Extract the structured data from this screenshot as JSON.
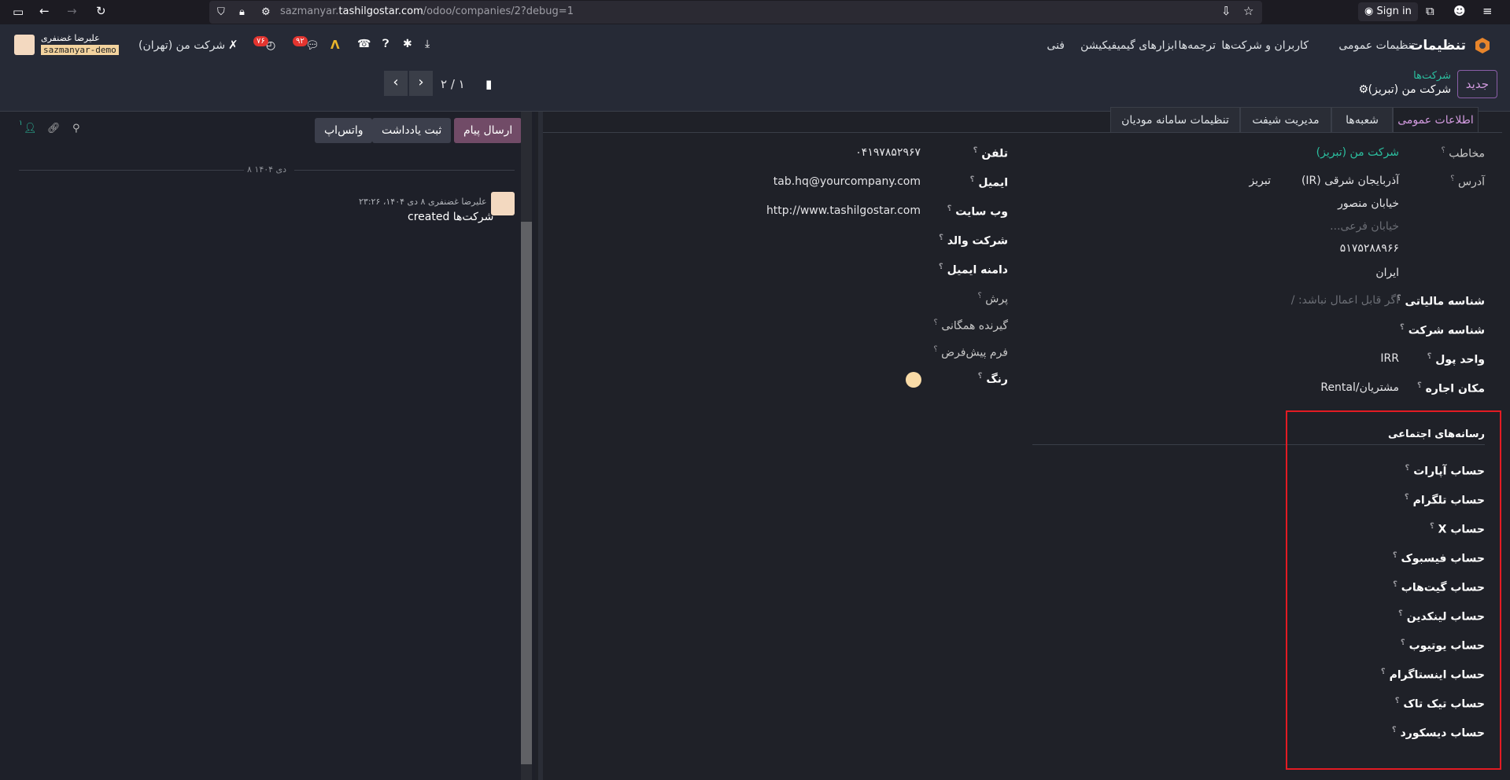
{
  "browser": {
    "url_prefix": "sazmanyar.",
    "url_domain": "tashilgostar.com",
    "url_path": "/odoo/companies/2?debug=1",
    "signin_label": "Sign in"
  },
  "navbar": {
    "app_name": "تنظیمات",
    "menu": [
      "تنظیمات عمومی",
      "کاربران و شرکت‌ها",
      "ترجمه‌ها",
      "ابزارهای گیمیفیکیشن",
      "فنی"
    ],
    "company": "شرکت من (تهران)",
    "user_name": "علیرضا غضنفری",
    "database": "sazmanyar-demo",
    "badge_activities": "۷۶",
    "badge_messages": "۹۲"
  },
  "control": {
    "new_label": "جدید",
    "breadcrumb_parent": "شرکت‌ها",
    "breadcrumb_current": "شرکت من (تبریز)",
    "pager": "۲ / ۱"
  },
  "chatter": {
    "send_message": "ارسال پیام",
    "log_note": "ثبت یادداشت",
    "whatsapp": "واتس‌اپ",
    "followers_count": "۱",
    "date_separator": "۸ دی ۱۴۰۴",
    "message_author": "علیرضا غضنفری",
    "message_time": "۸ دی ۱۴۰۴، ۲۳:۲۶",
    "message_body": "شرکت‌ها created"
  },
  "tabs": [
    "اطلاعات عمومی",
    "شعبه‌ها",
    "مدیریت شیفت",
    "تنظیمات سامانه مودیان"
  ],
  "left_fields": {
    "contact_label": "مخاطب",
    "contact_value": "شرکت من (تبریز)",
    "address_label": "آدرس",
    "state": "آذربایجان شرقی (IR)",
    "city": "تبریز",
    "street": "خیابان منصور",
    "street2_placeholder": "خیابان فرعی...",
    "zip": "۵۱۷۵۲۸۸۹۶۶",
    "country": "ایران",
    "tax_id_label": "شناسه مالیاتی",
    "tax_id_placeholder": "اگر قابل اعمال نباشد: /",
    "company_id_label": "شناسه شرکت",
    "currency_label": "واحد پول",
    "currency_value": "IRR",
    "rental_label": "مکان اجاره",
    "rental_value": "مشتریان/Rental"
  },
  "right_fields": {
    "phone_label": "تلفن",
    "phone_value": "۰۴۱۹۷۸۵۲۹۶۷",
    "email_label": "ایمیل",
    "email_value": "tab.hq@yourcompany.com",
    "website_label": "وب سایت",
    "website_value": "http://www.tashilgostar.com",
    "parent_label": "شرکت والد",
    "email_domain_label": "دامنه ایمیل",
    "pec_label": "پرش",
    "broadcast_label": "گیرنده همگانی",
    "default_form_label": "فرم پیش‌فرض",
    "color_label": "رنگ",
    "color_value": "#f9dba7"
  },
  "social": {
    "title": "رسانه‌های اجتماعی",
    "accounts": [
      "حساب آپارات",
      "حساب تلگرام",
      "حساب X",
      "حساب فیسبوک",
      "حساب گیت‌هاب",
      "حساب لینکدین",
      "حساب یوتیوب",
      "حساب اینستاگرام",
      "حساب تیک تاک",
      "حساب دیسکورد"
    ]
  }
}
